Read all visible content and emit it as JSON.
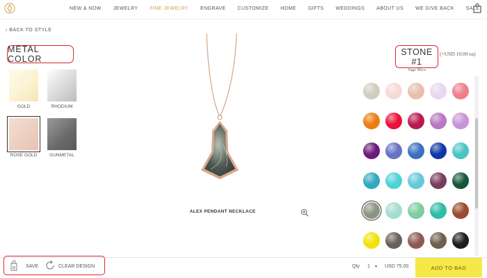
{
  "nav": {
    "items": [
      {
        "label": "NEW & NOW"
      },
      {
        "label": "JEWELRY"
      },
      {
        "label": "FINE JEWELRY"
      },
      {
        "label": "ENGRAVE"
      },
      {
        "label": "CUSTOMIZE"
      },
      {
        "label": "HOME"
      },
      {
        "label": "GIFTS"
      },
      {
        "label": "WEDDINGS"
      },
      {
        "label": "ABOUT US"
      },
      {
        "label": "WE GIVE BACK"
      },
      {
        "label": "SALE"
      }
    ],
    "accent_color": "#c9a34a"
  },
  "back_link": "‹ BACK TO STYLE",
  "metal": {
    "title": "METAL COLOR",
    "options": [
      {
        "label": "GOLD"
      },
      {
        "label": "RHODIUM"
      },
      {
        "label": "ROSE GOLD",
        "selected": true
      },
      {
        "label": "GUNMETAL"
      }
    ]
  },
  "product": {
    "name": "ALEX PENDANT NECKLACE"
  },
  "stone": {
    "title": "STONE #1",
    "selected_name": "Sage Mica",
    "price_note": "(+USD 10.00 ea)",
    "swatches": [
      {
        "color": "#cfcdbf"
      },
      {
        "color": "#f7d9d6"
      },
      {
        "color": "#e8bfae"
      },
      {
        "color": "#e9d6f0"
      },
      {
        "color": "#ef7e8a"
      },
      {
        "color": "#ec7d11"
      },
      {
        "color": "#e8103a"
      },
      {
        "color": "#b8194f"
      },
      {
        "color": "#b978c1"
      },
      {
        "color": "#c994d6"
      },
      {
        "color": "#6b1a7c"
      },
      {
        "color": "#6473c4"
      },
      {
        "color": "#3a6fc0"
      },
      {
        "color": "#0f37a8"
      },
      {
        "color": "#4cc3c4"
      },
      {
        "color": "#31a9c0"
      },
      {
        "color": "#4ed2d6"
      },
      {
        "color": "#66c9d9"
      },
      {
        "color": "#7a3c5e"
      },
      {
        "color": "#16573a"
      },
      {
        "color": "#8a9580",
        "selected": true
      },
      {
        "color": "#a5dcd0"
      },
      {
        "color": "#7fcda0"
      },
      {
        "color": "#2fbba6"
      },
      {
        "color": "#9b4a2e"
      },
      {
        "color": "#f1e30a"
      },
      {
        "color": "#6a5f5a"
      },
      {
        "color": "#8d5a52"
      },
      {
        "color": "#6e5f4e"
      },
      {
        "color": "#1e1e1e"
      }
    ]
  },
  "footer": {
    "save_label": "SAVE",
    "clear_label": "CLEAR DESIGN",
    "qty_label": "Qty",
    "qty_value": "1",
    "price": "USD 75.00",
    "add_to_bag_label": "ADD TO BAG"
  }
}
